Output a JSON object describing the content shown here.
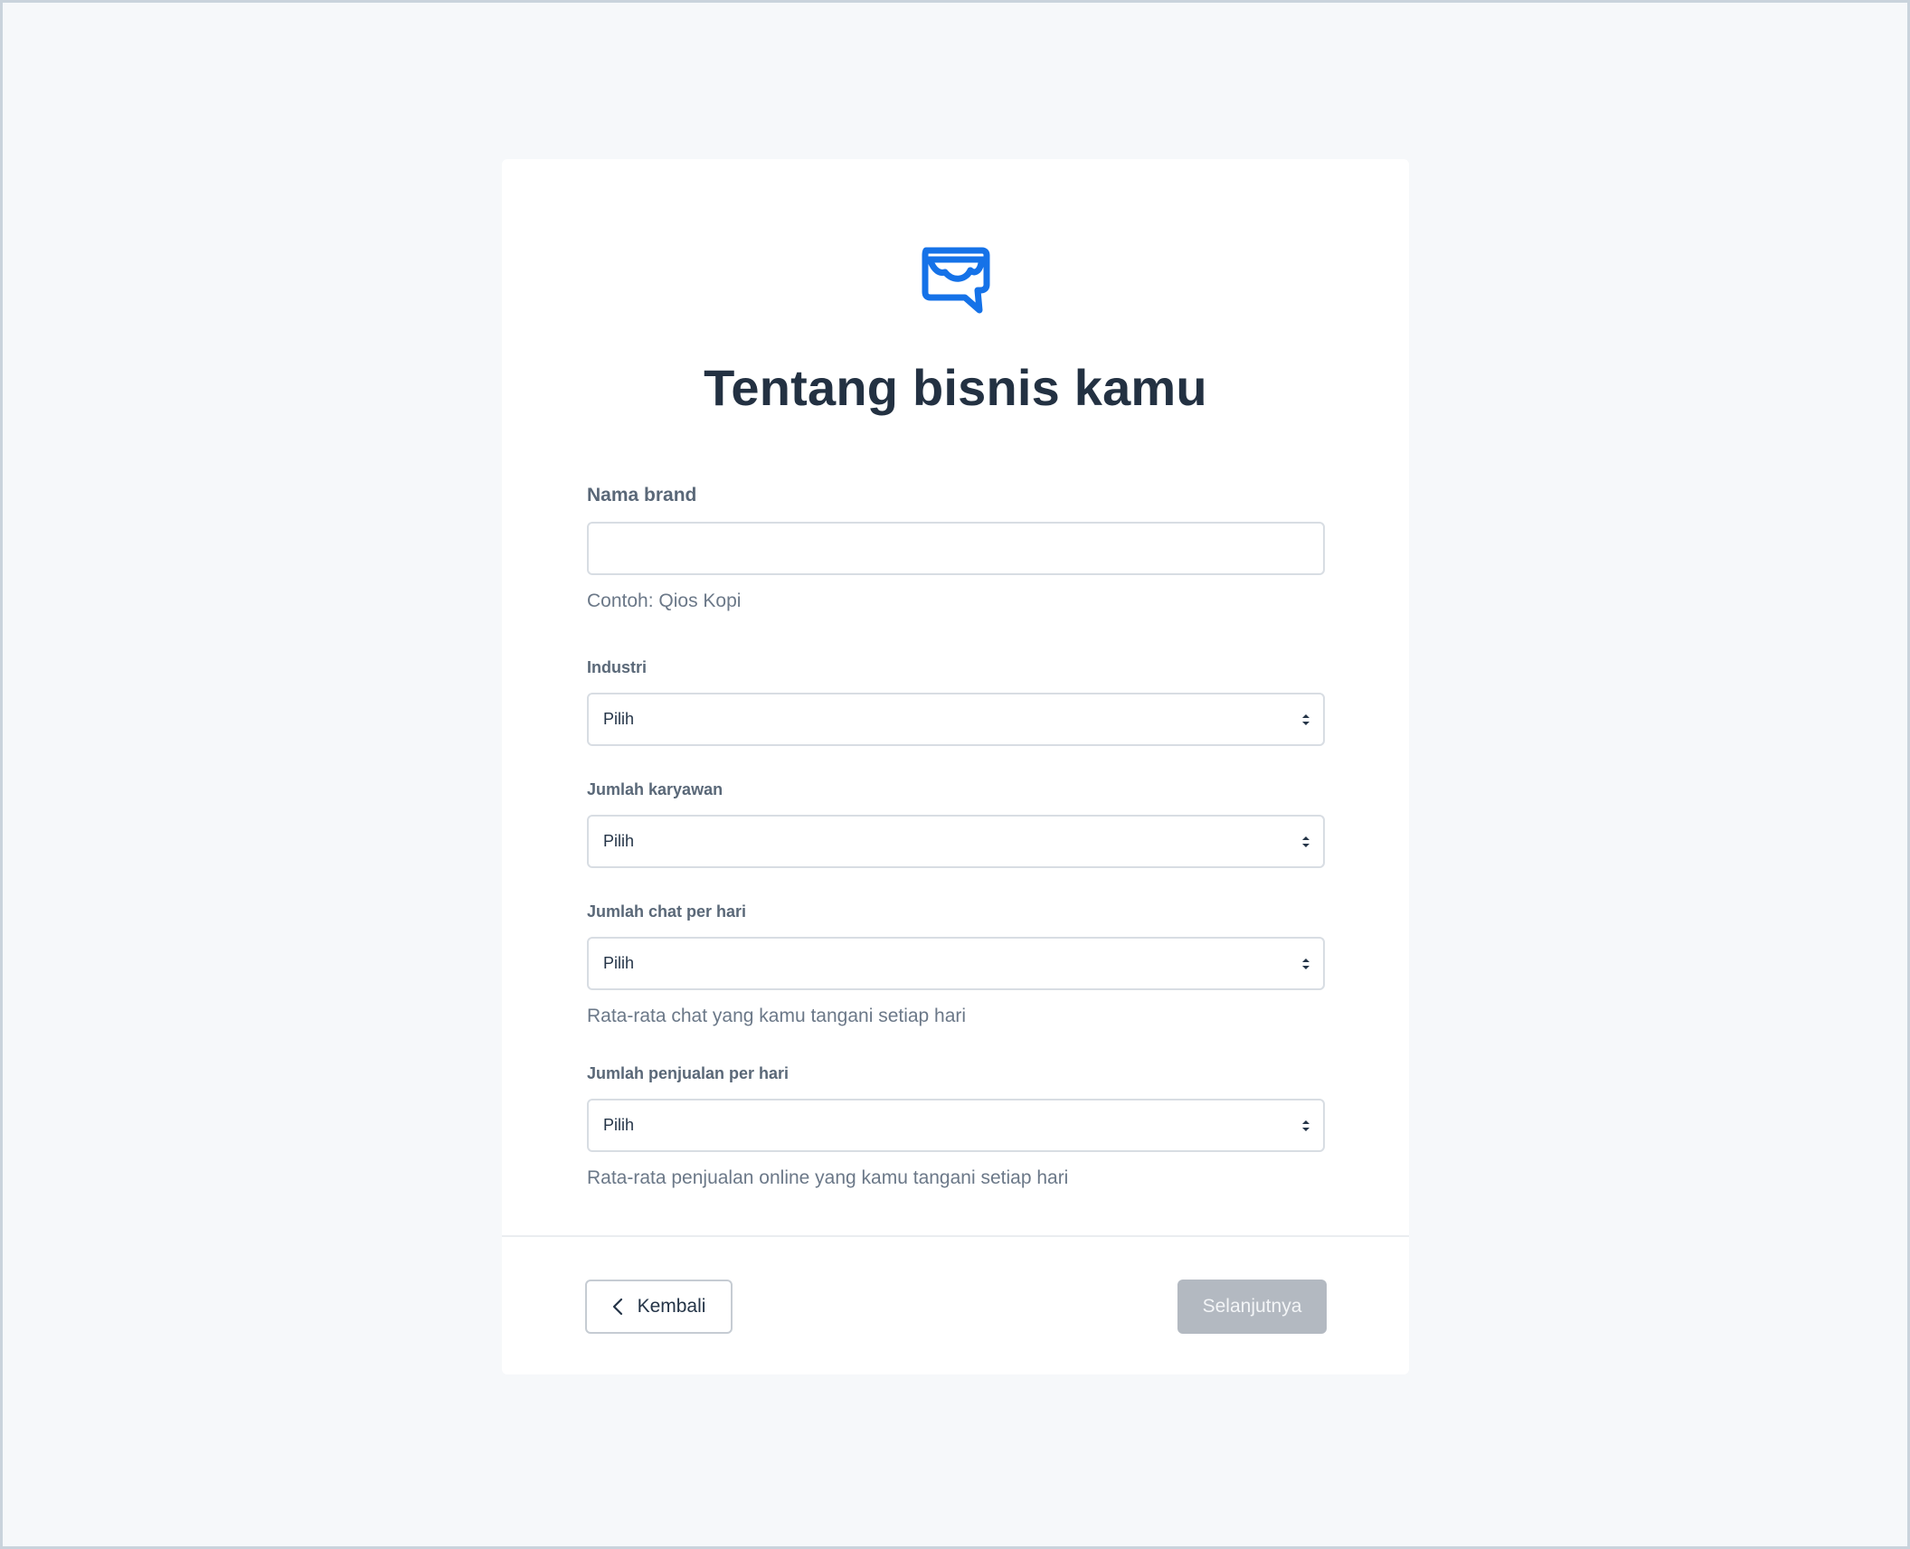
{
  "page": {
    "title": "Tentang bisnis kamu",
    "logo_icon": "chat-shop-icon",
    "accent_color": "#1572e8"
  },
  "form": {
    "brand_name": {
      "label": "Nama brand",
      "value": "",
      "helper": "Contoh: Qios Kopi"
    },
    "industry": {
      "label": "Industri",
      "selected": "Pilih"
    },
    "employees": {
      "label": "Jumlah karyawan",
      "selected": "Pilih"
    },
    "chats_per_day": {
      "label": "Jumlah chat per hari",
      "selected": "Pilih",
      "helper": "Rata-rata chat yang kamu tangani setiap hari"
    },
    "sales_per_day": {
      "label": "Jumlah penjualan per hari",
      "selected": "Pilih",
      "helper": "Rata-rata penjualan online yang kamu tangani setiap hari"
    }
  },
  "footer": {
    "back_label": "Kembali",
    "back_icon": "chevron-left-icon",
    "next_label": "Selanjutnya",
    "next_disabled_color": "#b3b9c1"
  }
}
